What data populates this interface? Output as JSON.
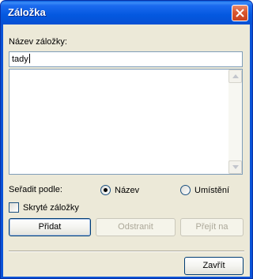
{
  "window": {
    "title": "Záložka"
  },
  "form": {
    "name_label": "Název záložky:",
    "name_value": "tady",
    "sort_label": "Seřadit podle:",
    "sort_options": [
      {
        "label": "Název",
        "selected": true
      },
      {
        "label": "Umístění",
        "selected": false
      }
    ],
    "hidden_label": "Skryté záložky",
    "hidden_checked": false
  },
  "buttons": {
    "add": "Přidat",
    "remove": "Odstranit",
    "goto": "Přejít na",
    "close": "Zavřít"
  },
  "icons": {
    "close": "close-x-icon",
    "scroll_up": "arrow-up-icon",
    "scroll_down": "arrow-down-icon"
  },
  "colors": {
    "titlebar": "#0458e0",
    "close_button": "#d9572f",
    "client": "#ece9d8"
  }
}
